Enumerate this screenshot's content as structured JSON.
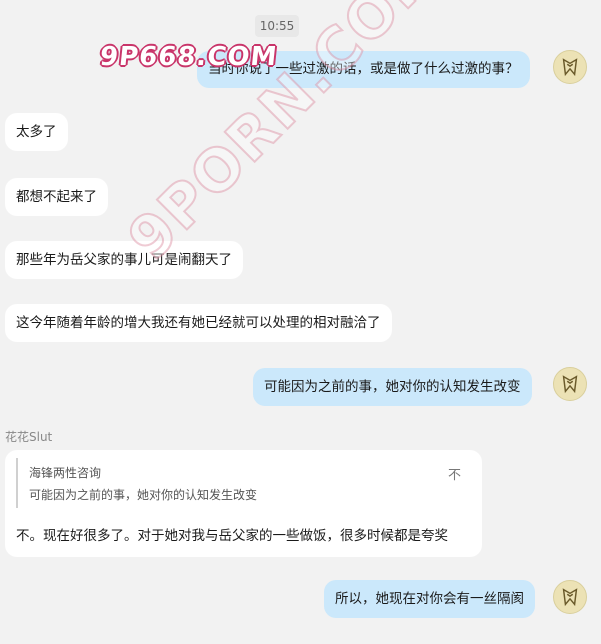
{
  "chat": {
    "timestamp": "10:55",
    "messages": [
      {
        "side": "out",
        "text": "当时你说了一些过激的话，或是做了什么过激的事？"
      },
      {
        "side": "in",
        "text": "太多了"
      },
      {
        "side": "in",
        "text": "都想不起来了"
      },
      {
        "side": "in",
        "text": "那些年为岳父家的事儿可是闹翻天了"
      },
      {
        "side": "in",
        "text": "这今年随着年龄的增大我还有她已经就可以处理的相对融洽了"
      },
      {
        "side": "out",
        "text": "可能因为之前的事，她对你的认知发生改变"
      },
      {
        "side": "out",
        "text": "所以，她现在对你会有一丝隔阂"
      }
    ],
    "reply": {
      "sender": "花花Slut",
      "quote_author": "海锋两性咨询",
      "quote_text": "可能因为之前的事，她对你的认知发生改变",
      "quote_icon": "不",
      "text": "不。现在好很多了。对于她对我与岳父家的一些做饭，很多时候都是夸奖"
    }
  },
  "watermarks": {
    "logo": "9P668.COM",
    "diagonal": "9PORN.COM"
  },
  "icons": {
    "avatar": "emblem-avatar-icon"
  },
  "colors": {
    "background": "#f2f2f2",
    "incoming_bubble": "#ffffff",
    "outgoing_bubble": "#cbe8fb",
    "watermark": "#c9356a"
  }
}
